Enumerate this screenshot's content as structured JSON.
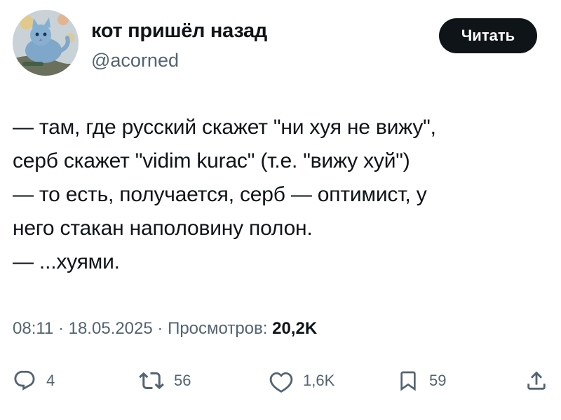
{
  "author": {
    "display_name": "кот пришёл назад",
    "handle": "@acorned",
    "avatar_icon": "cat-avatar"
  },
  "follow_button": {
    "label": "Читать"
  },
  "tweet": {
    "lines": [
      "— там, где русский скажет \"ни хуя не вижу\",",
      "серб скажет \"vidim kurac\" (т.е. \"вижу хуй\")",
      "— то есть, получается, серб — оптимист, у",
      "него стакан наполовину полон.",
      "— ...хуями."
    ]
  },
  "meta": {
    "time": "08:11",
    "separator": " · ",
    "date": "18.05.2025",
    "views_label": "Просмотров:",
    "views_count": "20,2K"
  },
  "actions": {
    "reply": {
      "icon": "reply-bubble-icon",
      "count": "4"
    },
    "repost": {
      "icon": "repost-arrows-icon",
      "count": "56"
    },
    "like": {
      "icon": "heart-icon",
      "count": "1,6K"
    },
    "bookmark": {
      "icon": "bookmark-icon",
      "count": "59"
    },
    "share": {
      "icon": "share-upload-icon"
    }
  },
  "colors": {
    "text": "#0f1419",
    "secondary": "#536471",
    "button_bg": "#0f1419",
    "button_text": "#ffffff",
    "background": "#ffffff"
  }
}
